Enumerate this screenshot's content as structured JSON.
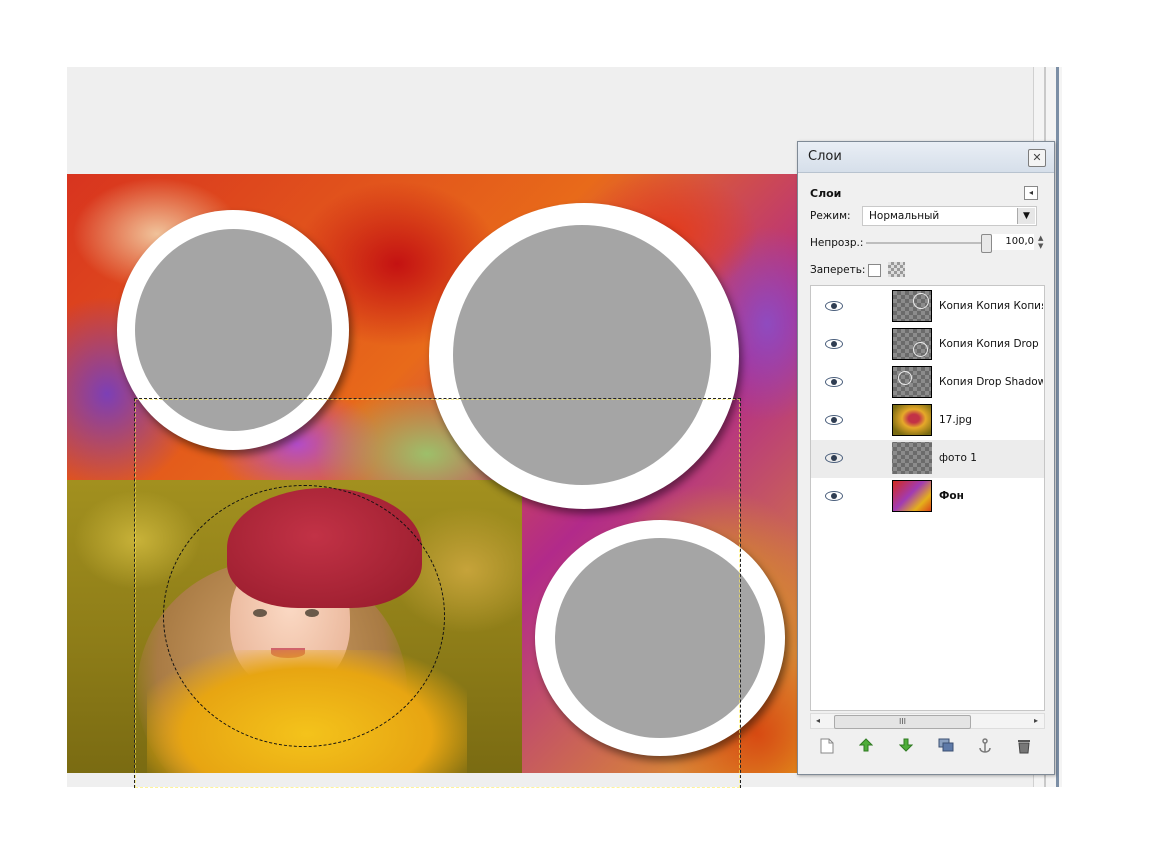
{
  "dialog": {
    "title": "Слои",
    "close_icon": "close-icon",
    "panel_title": "Слои",
    "mode_label": "Режим:",
    "mode_value": "Нормальный",
    "opacity_label": "Непрозр.:",
    "opacity_value": "100,0",
    "opacity_percent": 100,
    "lock_label": "Запереть:",
    "lock_pixels_checked": false
  },
  "layers": [
    {
      "name": "Копия Копия Копия",
      "visible": true,
      "thumb": "shadow-ring-small",
      "bold": false,
      "selected": false
    },
    {
      "name": "Копия Копия Drop",
      "visible": true,
      "thumb": "shadow-ring-small",
      "bold": false,
      "selected": false
    },
    {
      "name": "Копия Drop Shadow",
      "visible": true,
      "thumb": "shadow-ring-small",
      "bold": false,
      "selected": false
    },
    {
      "name": "17.jpg",
      "visible": true,
      "thumb": "photo",
      "bold": false,
      "selected": false
    },
    {
      "name": "фото 1",
      "visible": true,
      "thumb": "transparent",
      "bold": false,
      "selected": true
    },
    {
      "name": "Фон",
      "visible": true,
      "thumb": "background",
      "bold": true,
      "selected": false
    }
  ],
  "scrollbar": {
    "left_icon": "◂",
    "right_icon": "▸",
    "grip": "III"
  },
  "toolbar_icons": [
    "new-layer-icon",
    "raise-layer-icon",
    "lower-layer-icon",
    "duplicate-layer-icon",
    "anchor-layer-icon",
    "delete-layer-icon"
  ],
  "colors": {
    "frame": "#ffffff",
    "placeholder": "#a5a5a5",
    "selection": "#111111"
  }
}
